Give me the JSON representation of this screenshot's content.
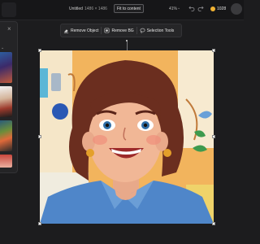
{
  "topbar": {
    "doc_title": "Untitled",
    "doc_size": "1486 × 1486",
    "fit_button": "Fit to content",
    "zoom": "41%",
    "credits": "1028"
  },
  "toolbar": {
    "remove_object": "Remove Object",
    "remove_bg": "Remove BG",
    "selection_tools": "Selection Tools"
  },
  "panel": {
    "close_glyph": "×"
  },
  "colors": {
    "accent_coin": "#f0b233",
    "panel_bg": "#242426"
  },
  "icons": [
    "logo",
    "undo-icon",
    "redo-icon",
    "coin-icon",
    "avatar",
    "eraser-icon",
    "remove-bg-icon",
    "lasso-icon",
    "close-icon"
  ]
}
